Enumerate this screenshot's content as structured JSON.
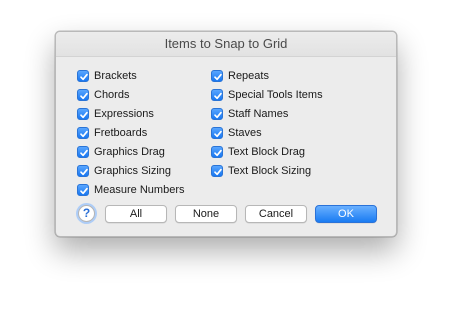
{
  "dialog": {
    "title": "Items to Snap to Grid"
  },
  "left_items": [
    {
      "label": "Brackets",
      "checked": true
    },
    {
      "label": "Chords",
      "checked": true
    },
    {
      "label": "Expressions",
      "checked": true
    },
    {
      "label": "Fretboards",
      "checked": true
    },
    {
      "label": "Graphics Drag",
      "checked": true
    },
    {
      "label": "Graphics Sizing",
      "checked": true
    },
    {
      "label": "Measure Numbers",
      "checked": true
    }
  ],
  "right_items": [
    {
      "label": "Repeats",
      "checked": true
    },
    {
      "label": "Special Tools Items",
      "checked": true
    },
    {
      "label": "Staff Names",
      "checked": true
    },
    {
      "label": "Staves",
      "checked": true
    },
    {
      "label": "Text Block Drag",
      "checked": true
    },
    {
      "label": "Text Block Sizing",
      "checked": true
    }
  ],
  "buttons": {
    "help": "?",
    "all": "All",
    "none": "None",
    "cancel": "Cancel",
    "ok": "OK"
  },
  "colors": {
    "accent": "#1a7bf2",
    "window_bg": "#ececec"
  }
}
